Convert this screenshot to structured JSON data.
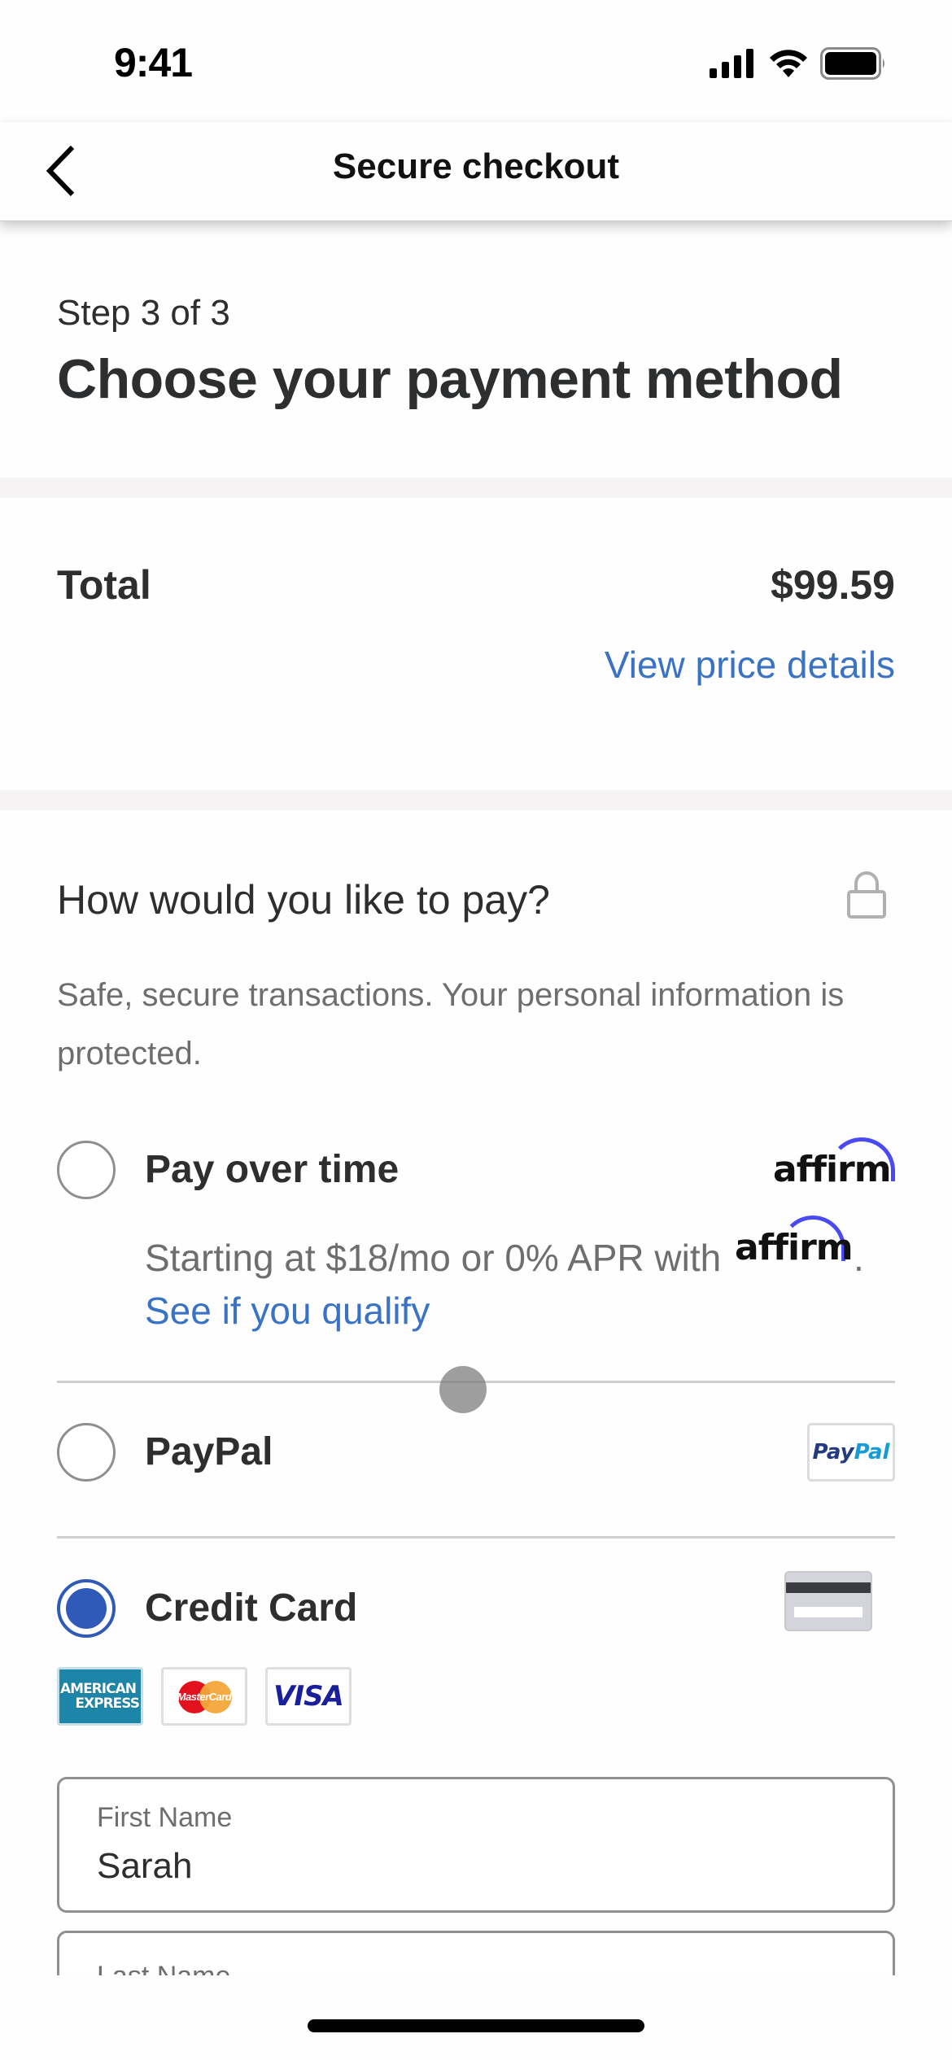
{
  "status_bar": {
    "time": "9:41",
    "icons": [
      "cellular-signal-icon",
      "wifi-icon",
      "battery-icon"
    ]
  },
  "nav": {
    "title": "Secure checkout",
    "back_icon": "chevron-left-icon"
  },
  "header": {
    "step": "Step 3 of 3",
    "title": "Choose your payment method"
  },
  "summary": {
    "total_label": "Total",
    "total_amount": "$99.59",
    "details_link": "View price details"
  },
  "payment": {
    "heading": "How would you like to pay?",
    "lock_icon": "lock-icon",
    "description": "Safe, secure transactions. Your personal information is protected.",
    "options": [
      {
        "id": "pay-over-time",
        "label": "Pay over time",
        "selected": false,
        "logo": "affirm",
        "detail_text": "Starting at $18/mo or 0% APR with",
        "detail_logo": "affirm",
        "detail_suffix": ".",
        "link": "See if you qualify"
      },
      {
        "id": "paypal",
        "label": "PayPal",
        "selected": false,
        "logo_dark": "Pay",
        "logo_light": "Pal"
      },
      {
        "id": "credit-card",
        "label": "Credit Card",
        "selected": true,
        "logo": "credit-card-icon",
        "accepted_cards": [
          {
            "name": "American Express",
            "line1": "AMERICAN",
            "line2": "EXPRESS"
          },
          {
            "name": "MasterCard",
            "text": "MasterCard"
          },
          {
            "name": "Visa",
            "text": "VISA"
          }
        ]
      }
    ]
  },
  "form": {
    "first_name": {
      "label": "First Name",
      "value": "Sarah"
    },
    "last_name": {
      "label": "Last Name",
      "value": ""
    }
  },
  "colors": {
    "accent_blue": "#2f5ab8",
    "link_blue": "#3a72c4",
    "text_dark": "#2c2e2f",
    "text_muted": "#6c6e70",
    "affirm_purple": "#4a4af4",
    "divider": "#f5f3f4"
  }
}
